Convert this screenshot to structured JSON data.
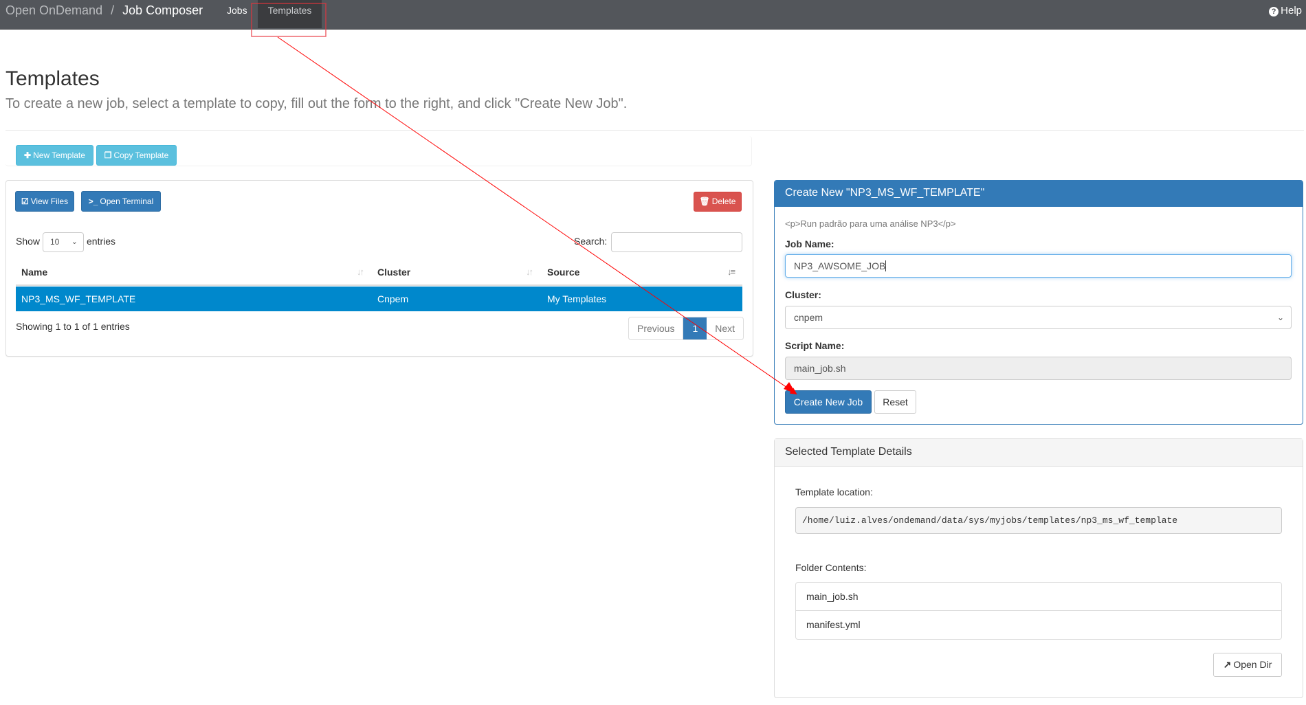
{
  "navbar": {
    "brand": "Open OnDemand",
    "separator": "/",
    "app_name": "Job Composer",
    "links": [
      {
        "label": "Jobs",
        "active": false
      },
      {
        "label": "Templates",
        "active": true
      }
    ],
    "help_label": "Help",
    "help_icon": "question-circle-icon"
  },
  "page": {
    "title": "Templates",
    "lead": "To create a new job, select a template to copy, fill out the form to the right, and click \"Create New Job\"."
  },
  "toolbar": {
    "new_template": {
      "label": "New Template",
      "icon": "plus-icon"
    },
    "copy_template": {
      "label": "Copy Template",
      "icon": "copy-icon"
    }
  },
  "templates_panel": {
    "view_files": {
      "label": "View Files",
      "icon": "edit-icon"
    },
    "open_terminal": {
      "label": "Open Terminal",
      "icon": "terminal-icon"
    },
    "delete": {
      "label": "Delete",
      "icon": "trash-icon"
    },
    "show_label": "Show",
    "entries_value": "10",
    "entries_label": "entries",
    "search_label": "Search:",
    "search_value": "",
    "columns": [
      "Name",
      "Cluster",
      "Source"
    ],
    "rows": [
      {
        "name": "NP3_MS_WF_TEMPLATE",
        "cluster": "Cnpem",
        "source": "My Templates",
        "selected": true
      }
    ],
    "info": "Showing 1 to 1 of 1 entries",
    "pagination": {
      "previous": "Previous",
      "current": "1",
      "next": "Next"
    }
  },
  "create_form": {
    "heading": "Create New \"NP3_MS_WF_TEMPLATE\"",
    "description": "<p>Run padrão para uma análise NP3</p>",
    "job_name_label": "Job Name:",
    "job_name_value": "NP3_AWSOME_JOB",
    "cluster_label": "Cluster:",
    "cluster_value": "cnpem",
    "script_name_label": "Script Name:",
    "script_name_value": "main_job.sh",
    "create_button": "Create New Job",
    "reset_button": "Reset"
  },
  "details": {
    "heading": "Selected Template Details",
    "location_label": "Template location:",
    "location_value": "/home/luiz.alves/ondemand/data/sys/myjobs/templates/np3_ms_wf_template",
    "folder_label": "Folder Contents:",
    "files": [
      "main_job.sh",
      "manifest.yml"
    ],
    "open_dir": {
      "label": "Open Dir",
      "icon": "external-link-icon"
    }
  },
  "annotation": {
    "color": "#ff0000",
    "description": "Red box around Templates tab with arrow pointing to Create New Job button"
  },
  "colors": {
    "navbar_bg": "#53565b",
    "primary": "#337ab7",
    "info": "#5bc0de",
    "danger": "#d9534f",
    "row_selected": "#0088cc"
  }
}
